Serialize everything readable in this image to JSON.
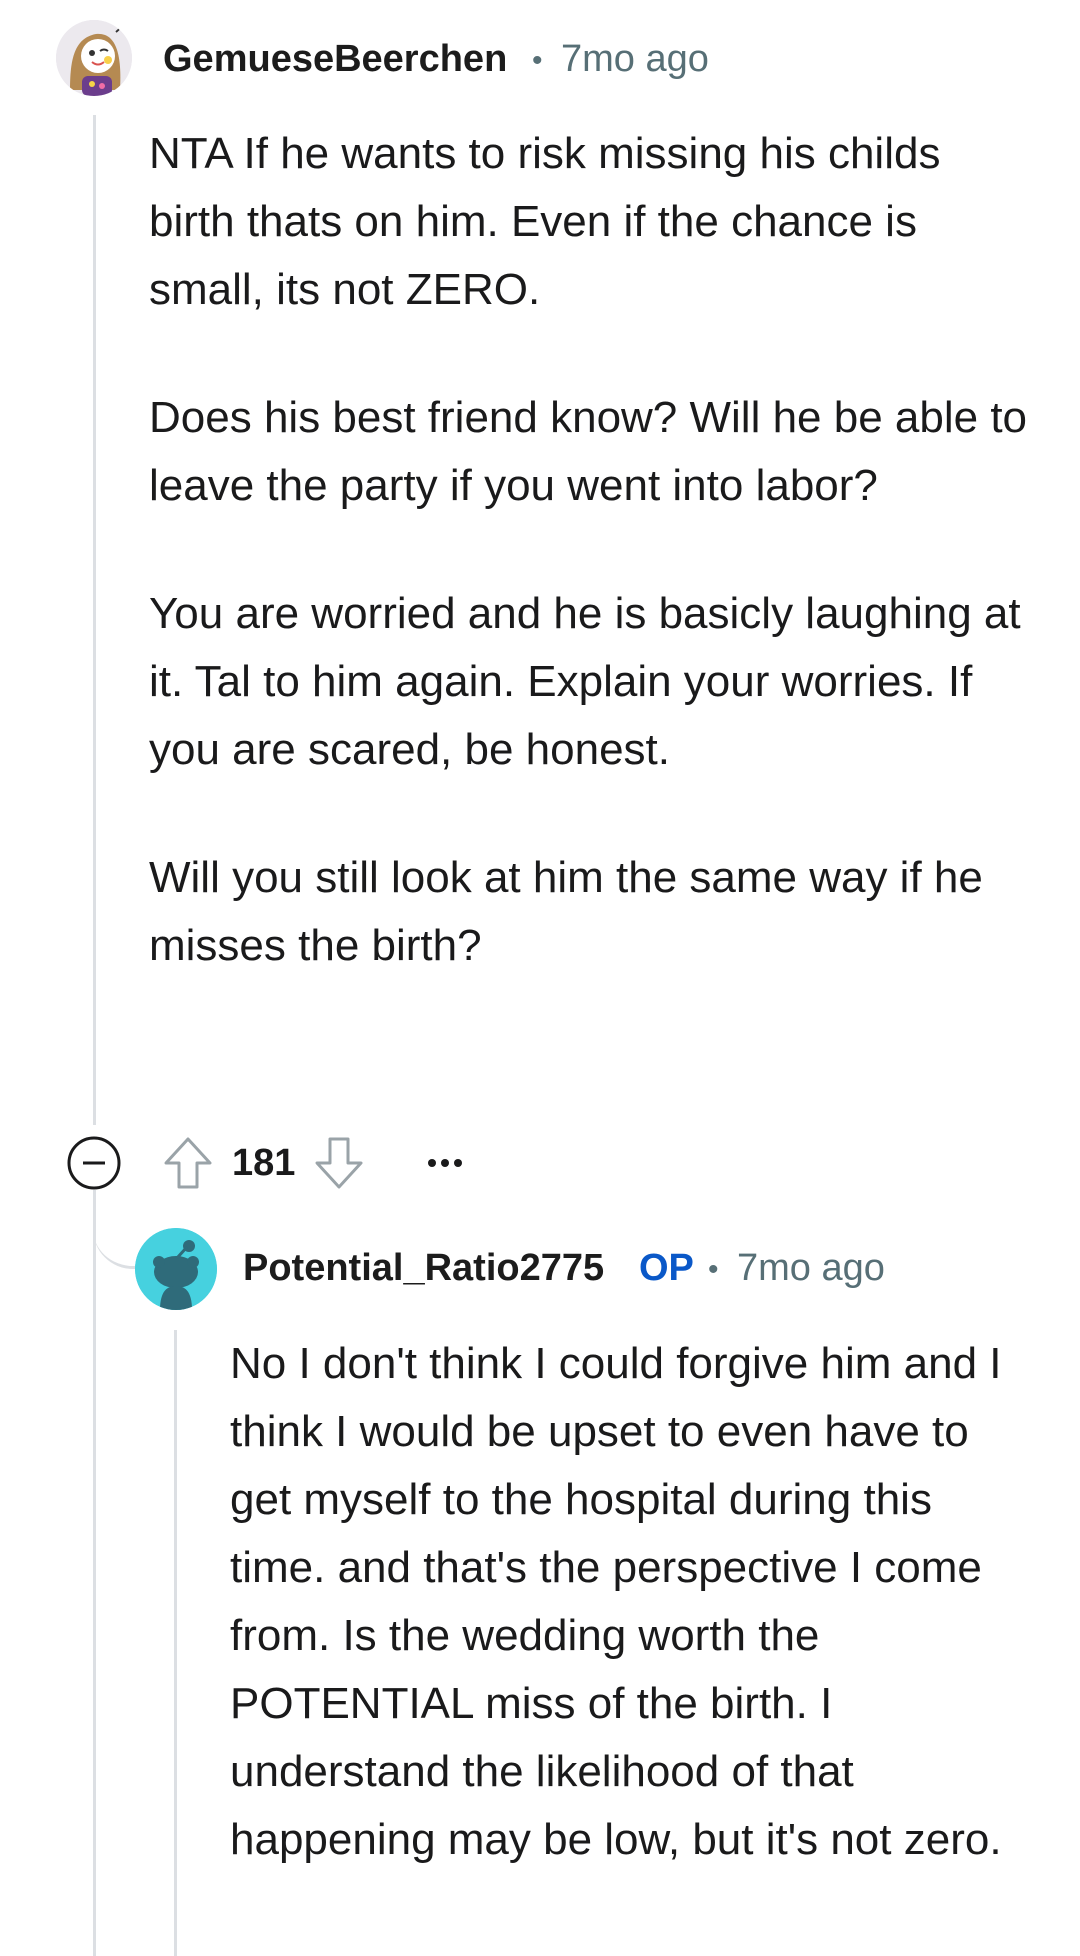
{
  "comment": {
    "author": "GemueseBeerchen",
    "separator": "•",
    "timestamp": "7mo ago",
    "paragraphs": [
      "NTA If he wants to risk missing his childs birth thats on him. Even if the chance is small, its not ZERO.",
      "Does his best friend know? Will he be able to leave the party if you went into labor?",
      "You are worried and he is basicly laughing at it. Tal to him again. Explain your worries. If you are scared, be honest.",
      "Will you still look at him the same way if he misses the birth?"
    ],
    "score": "181",
    "collapse_icon": "collapse-minus-icon",
    "upvote_icon": "upvote-arrow-icon",
    "downvote_icon": "downvote-arrow-icon",
    "more_icon": "more-options-icon"
  },
  "reply": {
    "author": "Potential_Ratio2775",
    "op_label": "OP",
    "separator": "•",
    "timestamp": "7mo ago",
    "text": "No I don't think I could forgive him and I think I would be upset to even have to get myself to the hospital during this time. and that's the perspective I come from. Is the wedding worth the POTENTIAL miss of the birth. I understand the likelihood of that happening may be low, but it's not zero."
  },
  "colors": {
    "op_badge": "#0a58c8",
    "meta_text": "#576f76",
    "thread_line": "#dcdfe3",
    "reply_avatar_bg": "#46d1df"
  }
}
